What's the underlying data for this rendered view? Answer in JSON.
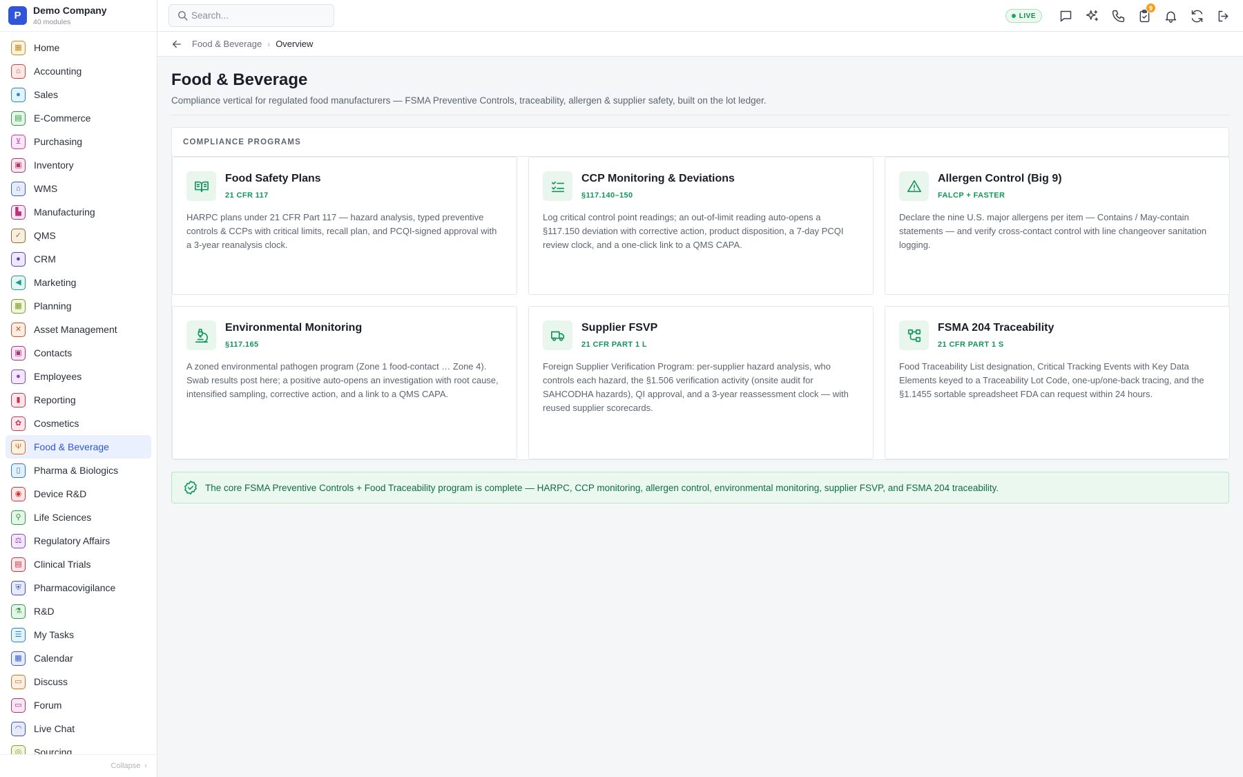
{
  "company": {
    "initial": "P",
    "name": "Demo Company",
    "subtitle": "40 modules"
  },
  "search": {
    "placeholder": "Search...",
    "value": ""
  },
  "topbar": {
    "live_label": "LIVE",
    "notification_count": "9"
  },
  "sidebar": {
    "items": [
      {
        "label": "Home",
        "icon": "grid-icon",
        "color": "#c08b1f",
        "bg": "#fbf3df",
        "glyph": "▦"
      },
      {
        "label": "Accounting",
        "icon": "bank-icon",
        "color": "#d0423b",
        "bg": "#fde8e6",
        "glyph": "⌂"
      },
      {
        "label": "Sales",
        "icon": "user-icon",
        "color": "#1f88c8",
        "bg": "#e3f2fb",
        "glyph": "●"
      },
      {
        "label": "E-Commerce",
        "icon": "store-icon",
        "color": "#2e9a45",
        "bg": "#e5f5e8",
        "glyph": "▤"
      },
      {
        "label": "Purchasing",
        "icon": "cart-icon",
        "color": "#c23ba3",
        "bg": "#fae6f4",
        "glyph": "⊻"
      },
      {
        "label": "Inventory",
        "icon": "box-icon",
        "color": "#b0356f",
        "bg": "#fbe6ef",
        "glyph": "▣"
      },
      {
        "label": "WMS",
        "icon": "warehouse-icon",
        "color": "#3a5fc8",
        "bg": "#e7ecfa",
        "glyph": "⌂"
      },
      {
        "label": "Manufacturing",
        "icon": "factory-icon",
        "color": "#b8327a",
        "bg": "#fbe5f0",
        "glyph": "▙"
      },
      {
        "label": "QMS",
        "icon": "badge-check-icon",
        "color": "#8a6a2a",
        "bg": "#f6efe0",
        "glyph": "✓"
      },
      {
        "label": "CRM",
        "icon": "users-icon",
        "color": "#5b3fc0",
        "bg": "#ede8fb",
        "glyph": "●"
      },
      {
        "label": "Marketing",
        "icon": "megaphone-icon",
        "color": "#1f9a8a",
        "bg": "#e2f6f3",
        "glyph": "◀"
      },
      {
        "label": "Planning",
        "icon": "calendar-icon",
        "color": "#7a9a1f",
        "bg": "#f1f6e0",
        "glyph": "▦"
      },
      {
        "label": "Asset Management",
        "icon": "tools-icon",
        "color": "#c8531f",
        "bg": "#fdece3",
        "glyph": "✕"
      },
      {
        "label": "Contacts",
        "icon": "contact-icon",
        "color": "#a8357f",
        "bg": "#f9e6f2",
        "glyph": "▣"
      },
      {
        "label": "Employees",
        "icon": "employee-icon",
        "color": "#8a3fc0",
        "bg": "#f2e8fb",
        "glyph": "●"
      },
      {
        "label": "Reporting",
        "icon": "bar-chart-icon",
        "color": "#c8324a",
        "bg": "#fde6ea",
        "glyph": "▮"
      },
      {
        "label": "Cosmetics",
        "icon": "flower-icon",
        "color": "#c83a5a",
        "bg": "#fde7ec",
        "glyph": "✿"
      },
      {
        "label": "Food & Beverage",
        "icon": "utensils-icon",
        "color": "#c8741f",
        "bg": "#fdf0e2",
        "glyph": "Ψ"
      },
      {
        "label": "Pharma & Biologics",
        "icon": "pill-icon",
        "color": "#1f7ac8",
        "bg": "#e3effb",
        "glyph": "▯"
      },
      {
        "label": "Device R&D",
        "icon": "cpu-icon",
        "color": "#c83a3a",
        "bg": "#fde7e7",
        "glyph": "◉"
      },
      {
        "label": "Life Sciences",
        "icon": "microscope-icon",
        "color": "#2e9a45",
        "bg": "#e5f5e8",
        "glyph": "⚲"
      },
      {
        "label": "Regulatory Affairs",
        "icon": "gavel-icon",
        "color": "#8a3fc0",
        "bg": "#f2e8fb",
        "glyph": "⚖"
      },
      {
        "label": "Clinical Trials",
        "icon": "clipboard-icon",
        "color": "#c8324a",
        "bg": "#fde6ea",
        "glyph": "▤"
      },
      {
        "label": "Pharmacovigilance",
        "icon": "shield-icon",
        "color": "#3a4fc8",
        "bg": "#e7eafa",
        "glyph": "⛨"
      },
      {
        "label": "R&D",
        "icon": "flask-icon",
        "color": "#2e9a45",
        "bg": "#e5f5e8",
        "glyph": "⚗"
      },
      {
        "label": "My Tasks",
        "icon": "checklist-icon",
        "color": "#1f88c8",
        "bg": "#e3f2fb",
        "glyph": "☰"
      },
      {
        "label": "Calendar",
        "icon": "calendar-days-icon",
        "color": "#3a5fc8",
        "bg": "#e7ecfa",
        "glyph": "▦"
      },
      {
        "label": "Discuss",
        "icon": "chat-icon",
        "color": "#c8741f",
        "bg": "#fdf0e2",
        "glyph": "▭"
      },
      {
        "label": "Forum",
        "icon": "messages-icon",
        "color": "#a8357f",
        "bg": "#f9e6f2",
        "glyph": "▭"
      },
      {
        "label": "Live Chat",
        "icon": "headset-icon",
        "color": "#3a4fc8",
        "bg": "#e7eafa",
        "glyph": "◠"
      },
      {
        "label": "Sourcing",
        "icon": "sourcing-icon",
        "color": "#8a9a1f",
        "bg": "#f1f6e0",
        "glyph": "◎"
      }
    ],
    "active_index": 17,
    "collapse_label": "Collapse"
  },
  "breadcrumb": {
    "parent": "Food & Beverage",
    "current": "Overview"
  },
  "page": {
    "title": "Food & Beverage",
    "description": "Compliance vertical for regulated food manufacturers — FSMA Preventive Controls, traceability, allergen & supplier safety, built on the lot ledger."
  },
  "programs": {
    "heading": "COMPLIANCE PROGRAMS",
    "cards": [
      {
        "title": "Food Safety Plans",
        "ref": "21 CFR 117",
        "icon": "book-open-icon",
        "desc": "HARPC plans under 21 CFR Part 117 — hazard analysis, typed preventive controls & CCPs with critical limits, recall plan, and PCQI-signed approval with a 3-year reanalysis clock."
      },
      {
        "title": "CCP Monitoring & Deviations",
        "ref": "§117.140–150",
        "icon": "list-checks-icon",
        "desc": "Log critical control point readings; an out-of-limit reading auto-opens a §117.150 deviation with corrective action, product disposition, a 7-day PCQI review clock, and a one-click link to a QMS CAPA."
      },
      {
        "title": "Allergen Control (Big 9)",
        "ref": "FALCP + FASTER",
        "icon": "warning-triangle-icon",
        "desc": "Declare the nine U.S. major allergens per item — Contains / May-contain statements — and verify cross-contact control with line changeover sanitation logging."
      },
      {
        "title": "Environmental Monitoring",
        "ref": "§117.165",
        "icon": "microscope-icon",
        "desc": "A zoned environmental pathogen program (Zone 1 food-contact … Zone 4). Swab results post here; a positive auto-opens an investigation with root cause, intensified sampling, corrective action, and a link to a QMS CAPA."
      },
      {
        "title": "Supplier FSVP",
        "ref": "21 CFR PART 1 L",
        "icon": "truck-icon",
        "desc": "Foreign Supplier Verification Program: per-supplier hazard analysis, who controls each hazard, the §1.506 verification activity (onsite audit for SAHCODHA hazards), QI approval, and a 3-year reassessment clock — with reused supplier scorecards."
      },
      {
        "title": "FSMA 204 Traceability",
        "ref": "21 CFR PART 1 S",
        "icon": "network-icon",
        "desc": "Food Traceability List designation, Critical Tracking Events with Key Data Elements keyed to a Traceability Lot Code, one-up/one-back tracing, and the §1.1455 sortable spreadsheet FDA can request within 24 hours."
      }
    ]
  },
  "banner": {
    "text": "The core FSMA Preventive Controls + Food Traceability program is complete — HARPC, CCP monitoring, allergen control, environmental monitoring, supplier FSVP, and FSMA 204 traceability.",
    "icon": "badge-check-icon"
  },
  "colors": {
    "accent": "#2f56d8",
    "success": "#13945a",
    "warning": "#f59f1b"
  }
}
